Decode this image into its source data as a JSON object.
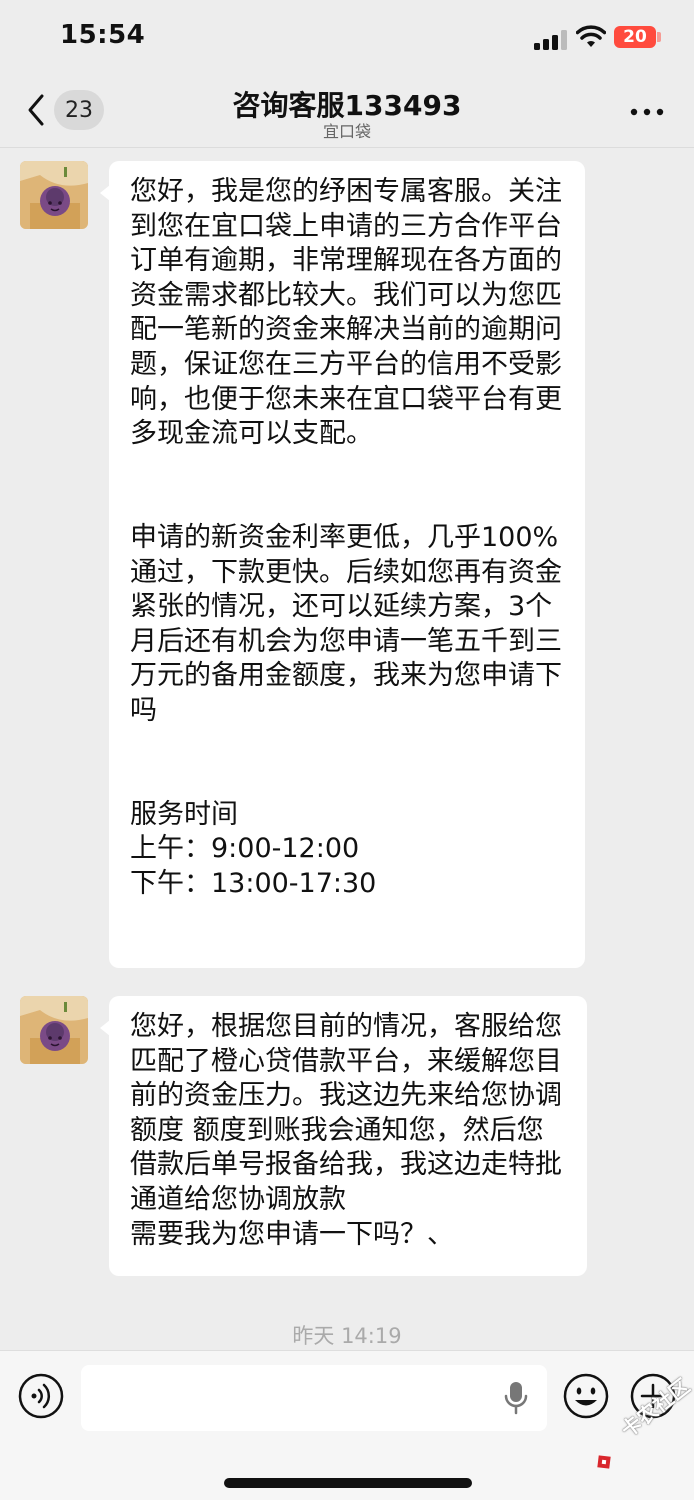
{
  "status_bar": {
    "time": "15:54",
    "battery": "20"
  },
  "nav": {
    "unread_count": "23",
    "title": "咨询客服133493",
    "subtitle": "宜口袋"
  },
  "messages": [
    {
      "sender": "agent",
      "text": "您好，我是您的纾困专属客服。关注到您在宜口袋上申请的三方合作平台订单有逾期，非常理解现在各方面的资金需求都比较大。我们可以为您匹配一笔新的资金来解决当前的逾期问题，保证您在三方平台的信用不受影响，也便于您未来在宜口袋平台有更多现金流可以支配。\n\n\n申请的新资金利率更低，几乎100%通过，下款更快。后续如您再有资金紧张的情况，还可以延续方案，3个月后还有机会为您申请一笔五千到三万元的备用金额度，我来为您申请下吗\n\n\n服务时间\n上午：9:00-12:00\n下午：13:00-17:30"
    },
    {
      "sender": "agent",
      "text": "您好，根据您目前的情况，客服给您匹配了橙心贷借款平台，来缓解您目前的资金压力。我这边先来给您协调额度 额度到账我会通知您，然后您借款后单号报备给我，我这边走特批通道给您协调放款\n需要我为您申请一下吗？、"
    }
  ],
  "timestamp": "昨天 14:19",
  "input": {
    "value": "",
    "placeholder": ""
  },
  "watermark": "卡农社区",
  "colors": {
    "background": "#ededed",
    "bubble": "#ffffff",
    "battery": "#ff4b3e"
  }
}
